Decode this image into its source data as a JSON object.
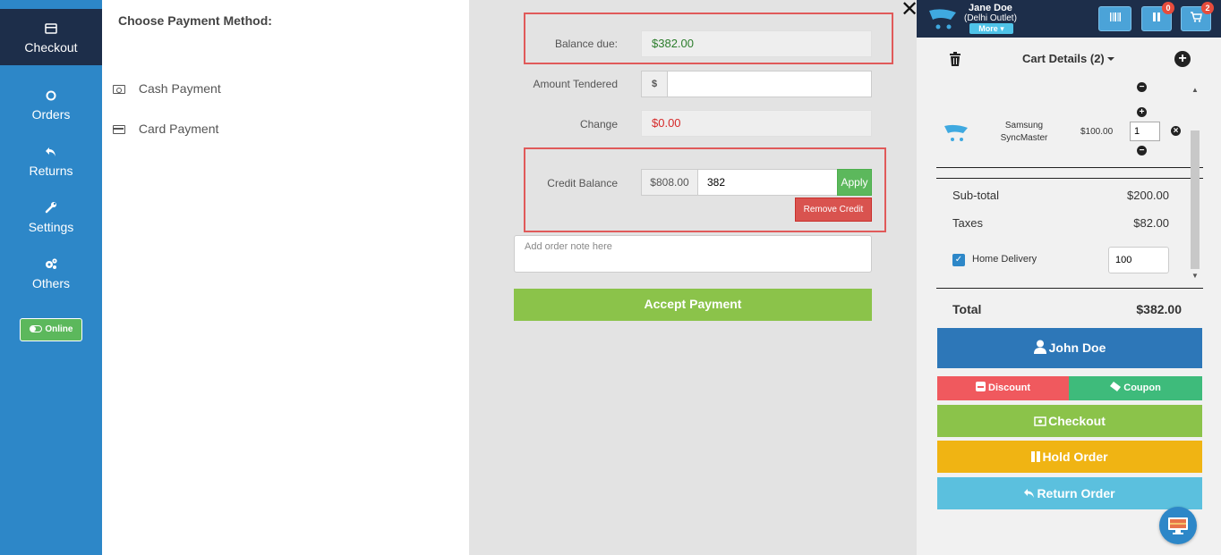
{
  "nav": {
    "items": [
      {
        "label": "Checkout",
        "icon": "money-icon"
      },
      {
        "label": "Orders",
        "icon": "circle-icon"
      },
      {
        "label": "Returns",
        "icon": "reply-icon"
      },
      {
        "label": "Settings",
        "icon": "wrench-icon"
      },
      {
        "label": "Others",
        "icon": "cogs-icon"
      }
    ],
    "online_label": "Online"
  },
  "methods": {
    "title": "Choose Payment Method:",
    "cash": "Cash Payment",
    "card": "Card Payment"
  },
  "payment": {
    "balance_label": "Balance due:",
    "balance_value": "$382.00",
    "tendered_label": "Amount Tendered",
    "tendered_addon": "$",
    "tendered_value": "",
    "change_label": "Change",
    "change_value": "$0.00",
    "credit_label": "Credit Balance",
    "credit_value": "$808.00",
    "credit_input": "382",
    "apply_label": "Apply",
    "remove_credit_label": "Remove Credit",
    "note_placeholder": "Add order note here",
    "accept_label": "Accept Payment"
  },
  "header": {
    "user_name": "Jane Doe",
    "outlet": "(Delhi Outlet)",
    "more_label": "More",
    "hold_badge": "0",
    "cart_badge": "2"
  },
  "cart": {
    "title": "Cart Details (2)",
    "item": {
      "name": "Samsung SyncMaster",
      "price": "$100.00",
      "qty": "1"
    },
    "subtotal_label": "Sub-total",
    "subtotal_value": "$200.00",
    "taxes_label": "Taxes",
    "taxes_value": "$82.00",
    "delivery_label": "Home Delivery",
    "delivery_value": "100",
    "total_label": "Total",
    "total_value": "$382.00"
  },
  "actions": {
    "customer": "John Doe",
    "discount": "Discount",
    "coupon": "Coupon",
    "checkout": "Checkout",
    "hold": "Hold Order",
    "return": "Return Order"
  },
  "colors": {
    "nav_bg": "#2d87c8",
    "nav_active": "#1d2e4a",
    "highlight": "#e05a5a",
    "accept": "#8bc34a"
  }
}
